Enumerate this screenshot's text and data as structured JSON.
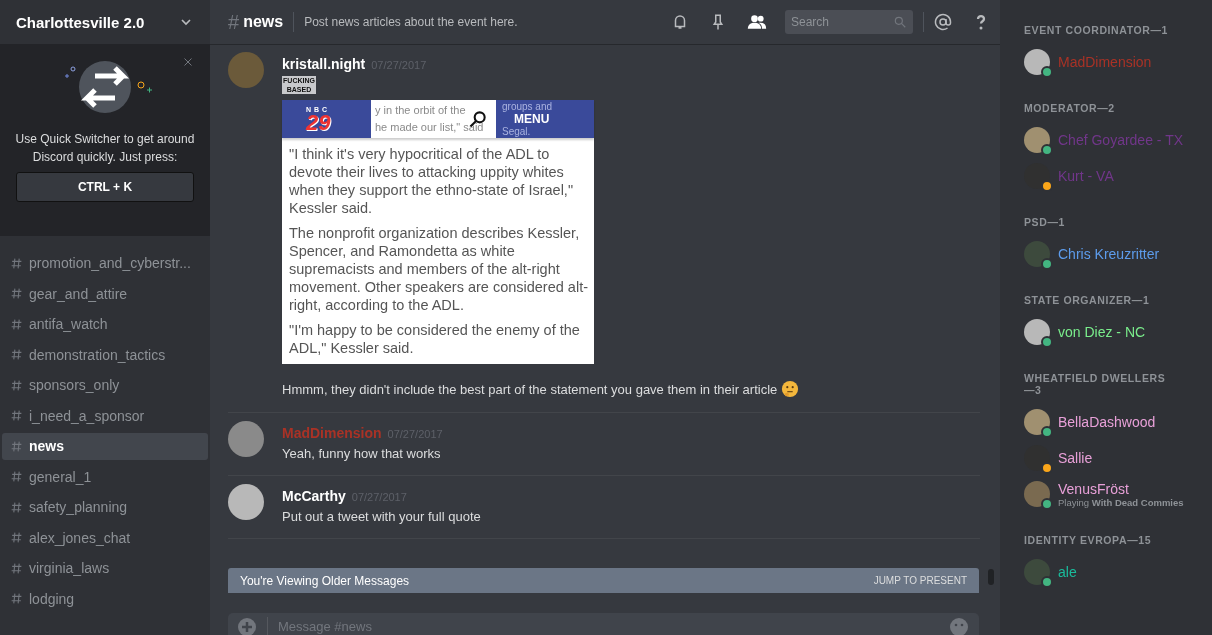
{
  "server": {
    "name": "Charlottesville 2.0"
  },
  "quick_switcher": {
    "text": "Use Quick Switcher to get around Discord quickly. Just press:",
    "shortcut": "CTRL + K"
  },
  "channels": [
    {
      "name": "promotion_and_cyberstr...",
      "selected": false
    },
    {
      "name": "gear_and_attire",
      "selected": false
    },
    {
      "name": "antifa_watch",
      "selected": false
    },
    {
      "name": "demonstration_tactics",
      "selected": false
    },
    {
      "name": "sponsors_only",
      "selected": false
    },
    {
      "name": "i_need_a_sponsor",
      "selected": false
    },
    {
      "name": "news",
      "selected": true
    },
    {
      "name": "general_1",
      "selected": false
    },
    {
      "name": "safety_planning",
      "selected": false
    },
    {
      "name": "alex_jones_chat",
      "selected": false
    },
    {
      "name": "virginia_laws",
      "selected": false
    },
    {
      "name": "lodging",
      "selected": false
    }
  ],
  "header": {
    "hash": "#",
    "channel": "news",
    "topic": "Post news articles about the event here.",
    "search": {
      "placeholder": "Search"
    },
    "members_on": true
  },
  "messages": [
    {
      "author": "kristall.night",
      "color": "#ffffff",
      "time": "07/27/2017",
      "kind": "article",
      "caption": "FUCKING BASED",
      "article": {
        "logo_top": "NBC",
        "logo": "29",
        "behind": [
          "y in the orbit of the",
          "he made our list,\" said"
        ],
        "behind_right": [
          "groups and",
          "Segal."
        ],
        "menu": "MENU",
        "paragraphs": [
          "\"I think it's very hypocritical of the ADL to devote their lives to attacking uppity whites when they support the ethno-state of Israel,\" Kessler said.",
          "The nonprofit organization describes Kessler, Spencer, and Ramondetta as white supremacists and members of the alt-right movement. Other speakers are considered alt-right, according to the ADL.",
          "\"I'm happy to be considered the enemy of the ADL,\" Kessler said."
        ]
      },
      "text": "Hmmm, they didn't include the best part of the statement you gave them in their article",
      "emoji": true
    },
    {
      "author": "MadDimension",
      "color": "#a93226",
      "time": "07/27/2017",
      "kind": "text",
      "text": "Yeah, funny how that works",
      "emoji": false
    },
    {
      "author": "McCarthy",
      "color": "#ffffff",
      "time": "07/27/2017",
      "kind": "text",
      "text": "Put out a tweet with your full quote",
      "emoji": false
    }
  ],
  "older_banner": {
    "text": "You're Viewing Older Messages",
    "action": "JUMP TO PRESENT"
  },
  "composer": {
    "placeholder": "Message #news"
  },
  "member_groups": [
    {
      "title": "EVENT COORDINATOR—1",
      "members": [
        {
          "name": "MadDimension",
          "color": "#a93226",
          "status_dot": {
            "color": "#43b581"
          }
        }
      ]
    },
    {
      "title": "MODERATOR—2",
      "members": [
        {
          "name": "Chef Goyardee - TX",
          "color": "#71368a",
          "status_dot": {
            "color": "#43b581"
          }
        },
        {
          "name": "Kurt - VA",
          "color": "#71368a",
          "status_dot": {
            "color": "#faa61a"
          }
        }
      ]
    },
    {
      "title": "PSD—1",
      "members": [
        {
          "name": "Chris Kreuzritter",
          "color": "#5d9cec",
          "status_dot": {
            "color": "#43b581"
          }
        }
      ]
    },
    {
      "title": "STATE ORGANIZER—1",
      "members": [
        {
          "name": "von Diez - NC",
          "color": "#7aed8c",
          "status_dot": {
            "color": "#43b581"
          }
        }
      ]
    },
    {
      "title": "WHEATFIELD DWELLERS—3",
      "members": [
        {
          "name": "BellaDashwood",
          "color": "#e8a0d8",
          "status_dot": {
            "color": "#43b581"
          }
        },
        {
          "name": "Sallie",
          "color": "#e8a0d8",
          "status_dot": {
            "color": "#faa61a"
          }
        },
        {
          "name": "VenusFröst",
          "color": "#e8a0d8",
          "status_dot": {
            "color": "#43b581"
          },
          "activity": "Playing **With Dead Commies**"
        }
      ]
    },
    {
      "title": "IDENTITY EVROPA—15",
      "members": [
        {
          "name": "ale",
          "color": "#1abc9c",
          "status_dot": {
            "color": "#43b581"
          }
        }
      ]
    }
  ]
}
